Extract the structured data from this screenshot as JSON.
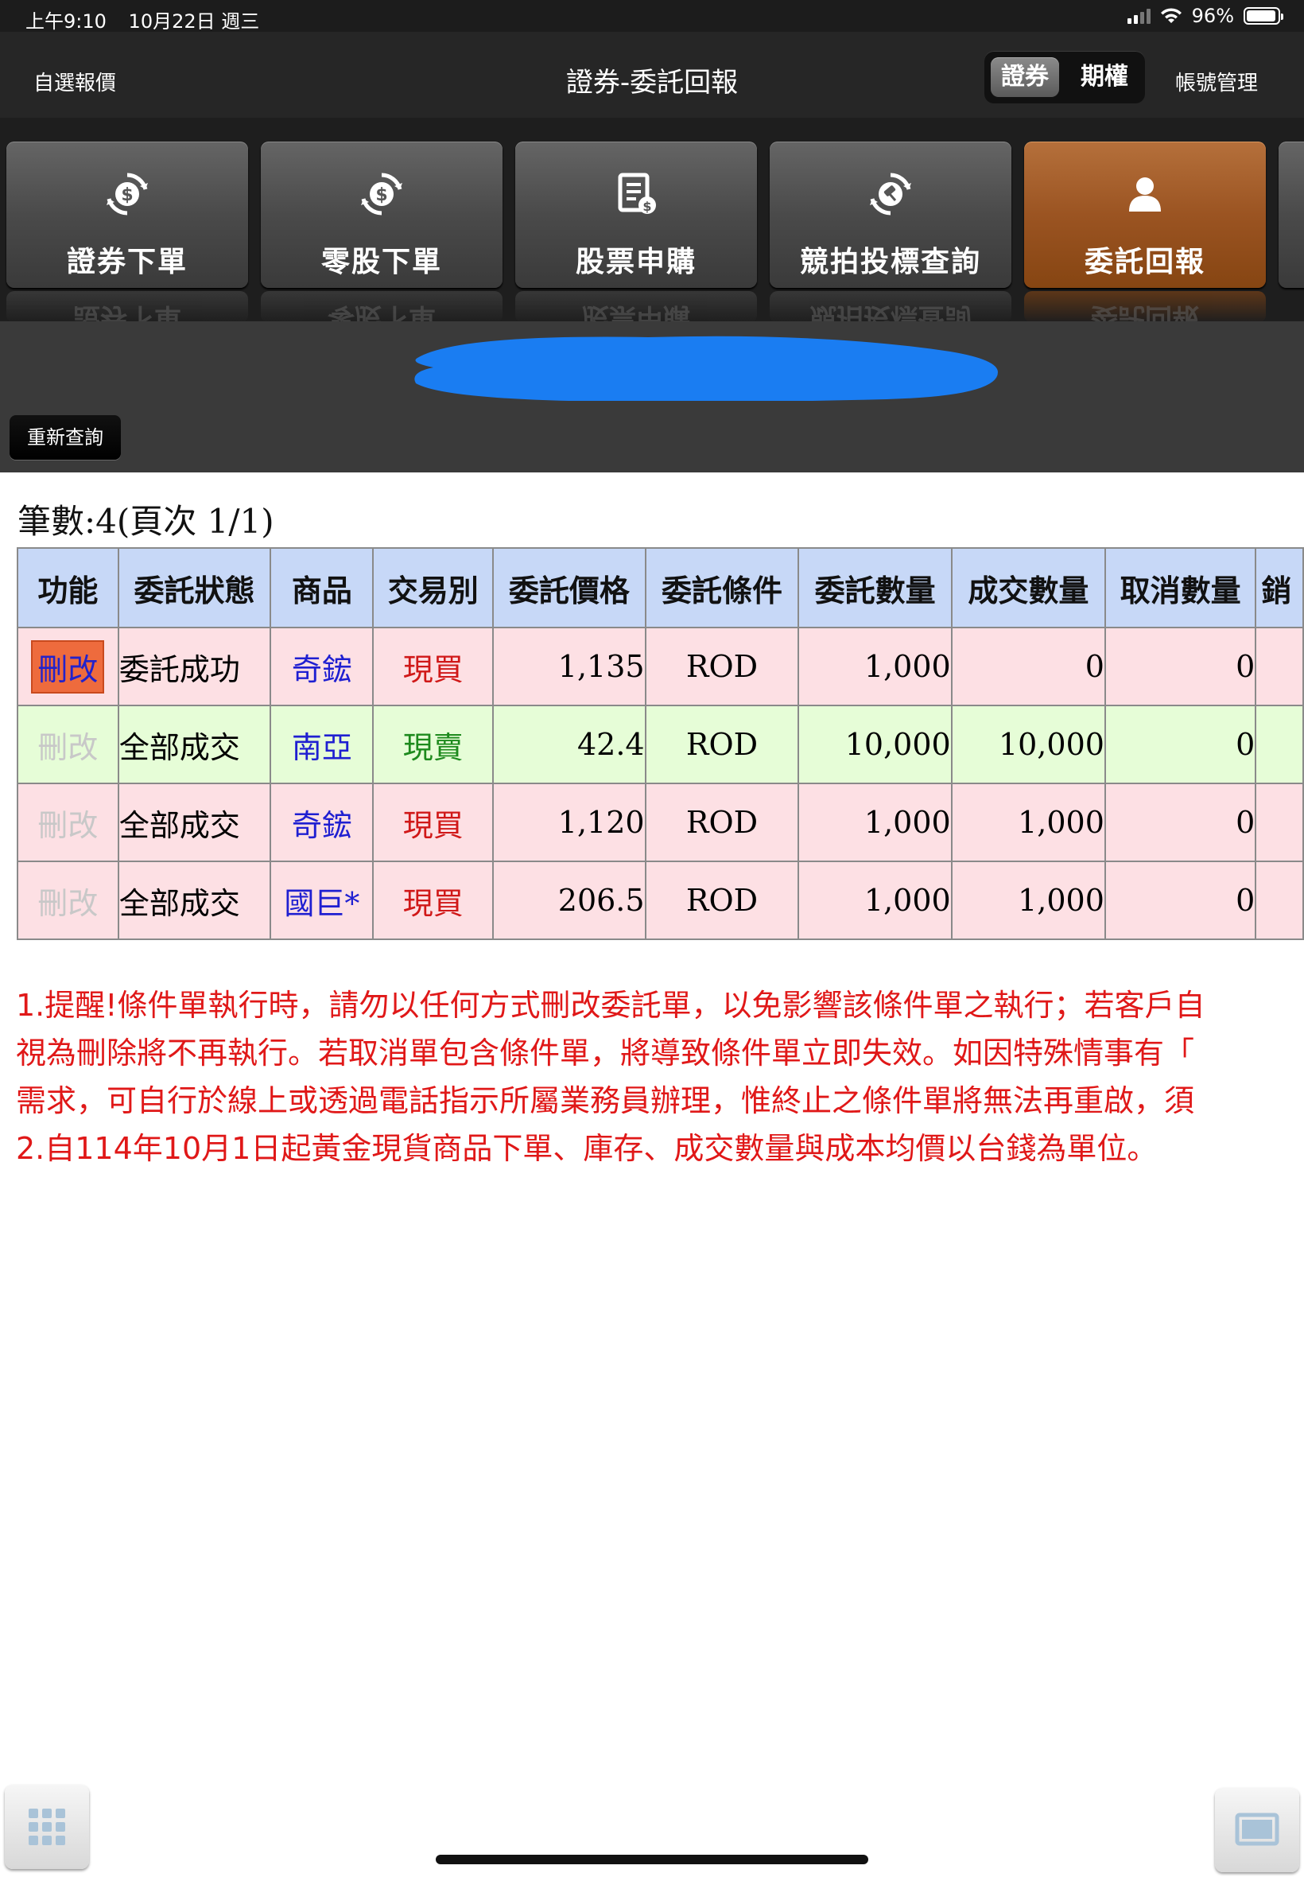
{
  "status_bar": {
    "time": "上午9:10",
    "date": "10月22日 週三",
    "battery": "96%",
    "battery_level": 0.96
  },
  "nav": {
    "left_label": "自選報價",
    "title": "證券-委託回報",
    "segments": [
      "證券",
      "期權"
    ],
    "active_segment": "證券",
    "right_label": "帳號管理"
  },
  "tools": [
    {
      "label": "證券下單",
      "icon": "dollar-refresh-icon",
      "active": false
    },
    {
      "label": "零股下單",
      "icon": "dollar-refresh-icon",
      "active": false
    },
    {
      "label": "股票申購",
      "icon": "document-dollar-icon",
      "active": false
    },
    {
      "label": "競拍投標查詢",
      "icon": "gavel-refresh-icon",
      "active": false
    },
    {
      "label": "委託回報",
      "icon": "person-icon",
      "active": true
    }
  ],
  "colors": {
    "redaction": "#1a7df2",
    "active_tile": "#9b5422",
    "header_bg": "#c7d8f7",
    "row_pink": "#fde0e4",
    "row_green": "#e6fdd7",
    "note_red": "#e01818"
  },
  "refresh_button": "重新查詢",
  "record_count": "筆數:4(頁次 1/1)",
  "table": {
    "headers": [
      "功能",
      "委託狀態",
      "商品",
      "交易別",
      "委託價格",
      "委託條件",
      "委託數量",
      "成交數量",
      "取消數量",
      "銷"
    ],
    "rows": [
      {
        "action": "刪改",
        "action_enabled": true,
        "status": "委託成功",
        "product": "奇鋐",
        "side": "現買",
        "price": "1,135",
        "condition": "ROD",
        "order_qty": "1,000",
        "filled_qty": "0",
        "cancel_qty": "0"
      },
      {
        "action": "刪改",
        "action_enabled": false,
        "status": "全部成交",
        "product": "南亞",
        "side": "現賣",
        "price": "42.4",
        "condition": "ROD",
        "order_qty": "10,000",
        "filled_qty": "10,000",
        "cancel_qty": "0"
      },
      {
        "action": "刪改",
        "action_enabled": false,
        "status": "全部成交",
        "product": "奇鋐",
        "side": "現買",
        "price": "1,120",
        "condition": "ROD",
        "order_qty": "1,000",
        "filled_qty": "1,000",
        "cancel_qty": "0"
      },
      {
        "action": "刪改",
        "action_enabled": false,
        "status": "全部成交",
        "product": "國巨*",
        "side": "現買",
        "price": "206.5",
        "condition": "ROD",
        "order_qty": "1,000",
        "filled_qty": "1,000",
        "cancel_qty": "0"
      }
    ]
  },
  "notes": [
    "1.提醒!條件單執行時，請勿以任何方式刪改委託單，以免影響該條件單之執行；若客戶自",
    "視為刪除將不再執行。若取消單包含條件單，將導致條件單立即失效。如因特殊情事有「",
    "需求，可自行於線上或透過電話指示所屬業務員辦理，惟終止之條件單將無法再重啟，須",
    "2.自114年10月1日起黃金現貨商品下單、庫存、成交數量與成本均價以台錢為單位。"
  ]
}
